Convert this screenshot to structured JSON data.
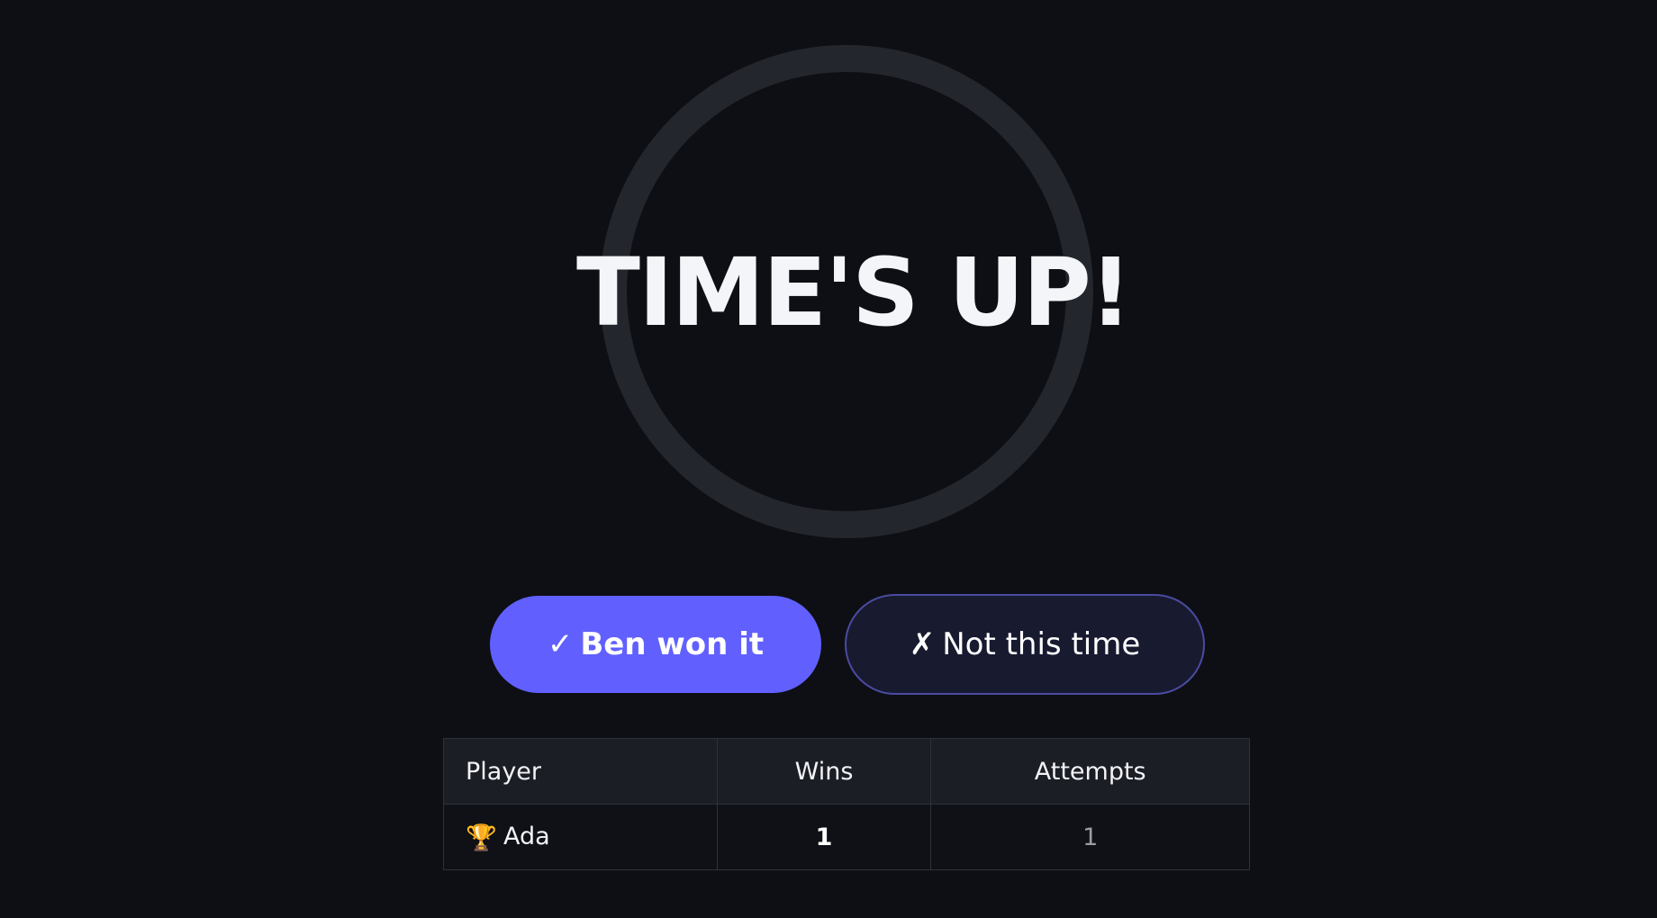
{
  "timer": {
    "status_text": "TIME'S UP!"
  },
  "actions": {
    "won_glyph": "✓",
    "won_label": "Ben won it",
    "not_glyph": "✗",
    "not_label": "Not this time"
  },
  "scoreboard": {
    "columns": [
      "Player",
      "Wins",
      "Attempts"
    ],
    "rows": [
      {
        "icon": "trophy-icon",
        "icon_glyph": "🏆",
        "player": "Ada",
        "wins": "1",
        "attempts": "1"
      }
    ]
  },
  "colors": {
    "background": "#0e0f14",
    "ring": "#24262d",
    "primary": "#6160ff",
    "secondary_bg": "#181a30",
    "secondary_border": "#4a4ba0"
  }
}
